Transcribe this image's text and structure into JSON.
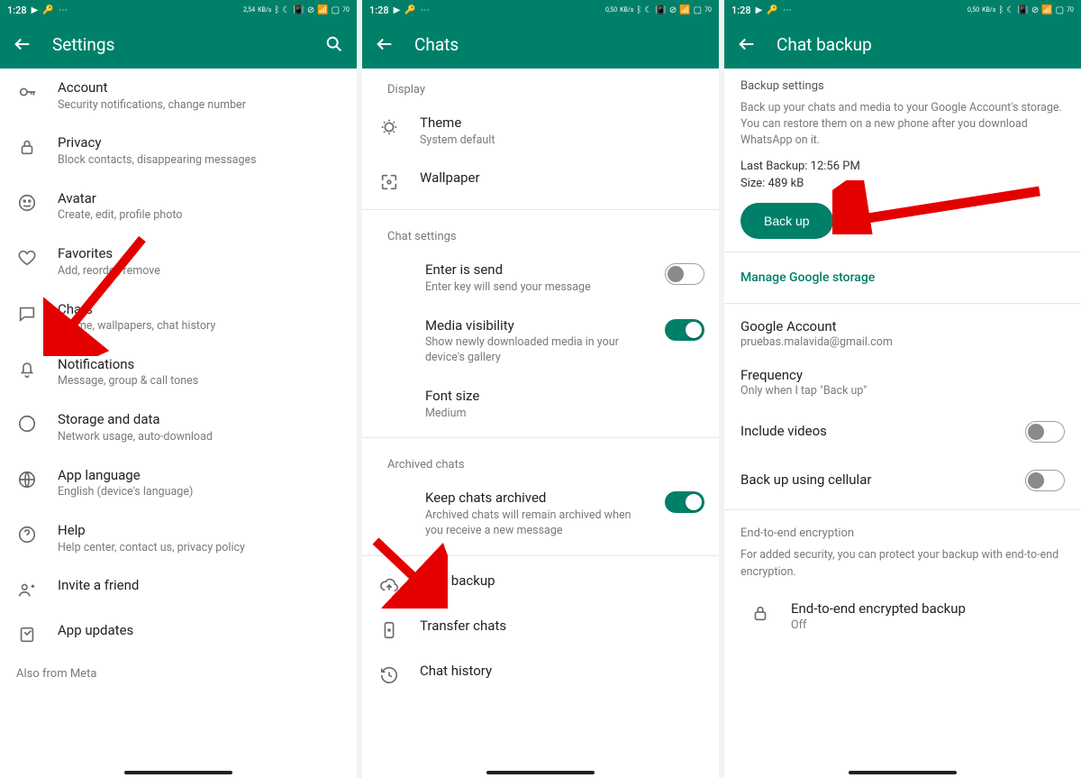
{
  "status": {
    "time": "1:28",
    "net": "2,54",
    "netUnit": "KB/s",
    "net2": "0,50",
    "net2b": "0,50",
    "battery": "70"
  },
  "s1": {
    "title": "Settings",
    "items": {
      "account": {
        "title": "Account",
        "sub": "Security notifications, change number"
      },
      "privacy": {
        "title": "Privacy",
        "sub": "Block contacts, disappearing messages"
      },
      "avatar": {
        "title": "Avatar",
        "sub": "Create, edit, profile photo"
      },
      "favorites": {
        "title": "Favorites",
        "sub": "Add, reorder, remove"
      },
      "chats": {
        "title": "Chats",
        "sub": "Theme, wallpapers, chat history"
      },
      "notif": {
        "title": "Notifications",
        "sub": "Message, group & call tones"
      },
      "storage": {
        "title": "Storage and data",
        "sub": "Network usage, auto-download"
      },
      "lang": {
        "title": "App language",
        "sub": "English (device's language)"
      },
      "help": {
        "title": "Help",
        "sub": "Help center, contact us, privacy policy"
      },
      "invite": {
        "title": "Invite a friend"
      },
      "updates": {
        "title": "App updates"
      }
    },
    "footer": "Also from Meta"
  },
  "s2": {
    "title": "Chats",
    "sections": {
      "display": "Display",
      "chat": "Chat settings",
      "arch": "Archived chats"
    },
    "items": {
      "theme": {
        "title": "Theme",
        "sub": "System default"
      },
      "wallpaper": {
        "title": "Wallpaper"
      },
      "enter": {
        "title": "Enter is send",
        "sub": "Enter key will send your message"
      },
      "media": {
        "title": "Media visibility",
        "sub": "Show newly downloaded media in your device's gallery"
      },
      "font": {
        "title": "Font size",
        "sub": "Medium"
      },
      "keep": {
        "title": "Keep chats archived",
        "sub": "Archived chats will remain archived when you receive a new message"
      },
      "backup": {
        "title": "Chat backup"
      },
      "transfer": {
        "title": "Transfer chats"
      },
      "history": {
        "title": "Chat history"
      }
    }
  },
  "s3": {
    "title": "Chat backup",
    "hdr1": "Backup settings",
    "desc": "Back up your chats and media to your Google Account's storage. You can restore them on a new phone after you download WhatsApp on it.",
    "last": "Last Backup: 12:56 PM",
    "size": "Size: 489 kB",
    "btn": "Back up",
    "link": "Manage Google storage",
    "google": {
      "title": "Google Account",
      "sub": "pruebas.malavida@gmail.com"
    },
    "freq": {
      "title": "Frequency",
      "sub": "Only when I tap \"Back up\""
    },
    "videos": "Include videos",
    "cell": "Back up using cellular",
    "hdr2": "End-to-end encryption",
    "desc2": "For added security, you can protect your backup with end-to-end encryption.",
    "e2e": {
      "title": "End-to-end encrypted backup",
      "sub": "Off"
    }
  }
}
